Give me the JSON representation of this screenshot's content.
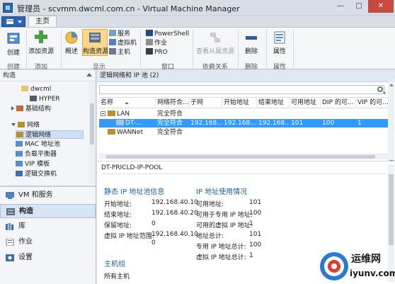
{
  "window": {
    "title": "管理员 - scvmm.dwcml.com.cn - Virtual Machine Manager",
    "minimize": "—",
    "maximize": "□",
    "close": "✕"
  },
  "ribbon": {
    "tab_home": "主页",
    "groups": {
      "create": "创建",
      "add": "添加",
      "show": "显示",
      "window": "窗口",
      "dependencies": "依赖关系",
      "delete": "删除",
      "properties": "属性"
    },
    "buttons": {
      "create": "创建",
      "add_resources": "添加资源",
      "overview": "概述",
      "fabric_resources": "构造资源",
      "services": "服务",
      "vms": "虚拟机",
      "hosts": "主机",
      "powershell": "PowerShell",
      "jobs": "作业",
      "pro": "PRO",
      "view_dependent": "查看从属资源",
      "delete": "删除",
      "properties": "属性"
    }
  },
  "nav": {
    "header": "构造",
    "tree": [
      {
        "label": "dwcml"
      },
      {
        "label": "HYPER"
      },
      {
        "label": "基础结构"
      },
      {
        "label": "网络"
      },
      {
        "label": "逻辑网络"
      },
      {
        "label": "MAC 地址池"
      },
      {
        "label": "负载平衡器"
      },
      {
        "label": "VIP 模板"
      },
      {
        "label": "逻辑交换机"
      }
    ],
    "workspaces": [
      {
        "label": "VM 和服务"
      },
      {
        "label": "构造"
      },
      {
        "label": "库"
      },
      {
        "label": "作业"
      },
      {
        "label": "设置"
      }
    ]
  },
  "main": {
    "header": "逻辑网络和 IP 池 (2)",
    "search_placeholder": "",
    "columns": [
      "名称",
      "网络符合...",
      "子网",
      "开始地址",
      "结束地址",
      "可用地址",
      "DIP 的可...",
      "VIP 的可..."
    ],
    "rows": [
      {
        "name": "LAN",
        "compliance": "完全符合",
        "subnet": "",
        "start": "",
        "end": "",
        "available": "",
        "dip": "",
        "vip": ""
      },
      {
        "name": "DT-...",
        "compliance": "完全符合",
        "subnet": "192.168....",
        "start": "192.168....",
        "end": "192.168....",
        "available": "101",
        "dip": "100",
        "vip": "1"
      },
      {
        "name": "WANNet",
        "compliance": "完全符合",
        "subnet": "",
        "start": "",
        "end": "",
        "available": "",
        "dip": "",
        "vip": ""
      }
    ]
  },
  "detail": {
    "title": "DT-PRICLD-IP-POOL",
    "static_pool_title": "静态 IP 地址池信息",
    "static_pool": [
      {
        "k": "开始地址:",
        "v": "192.168.40.10"
      },
      {
        "k": "结束地址:",
        "v": "192.168.40.20"
      },
      {
        "k": "保留地址:",
        "v": "0"
      },
      {
        "k": "虚拟 IP 地址范围:",
        "v": "192.168.40.10"
      },
      {
        "k": "",
        "v": "0"
      }
    ],
    "usage_title": "IP 地址使用情况",
    "usage": [
      {
        "k": "可用地址:",
        "v": "101"
      },
      {
        "k": "可用于专用 IP 地址:",
        "v": "100"
      },
      {
        "k": "可用的虚拟 IP 地址:",
        "v": "1"
      },
      {
        "k": "地址总计:",
        "v": "101"
      },
      {
        "k": "专用 IP 地址总计:",
        "v": "100"
      },
      {
        "k": "虚拟 IP 地址总计:",
        "v": "1"
      }
    ],
    "host_group_title": "主机组",
    "host_group_value": "所有主机"
  },
  "watermark": {
    "text": "运维网",
    "url": "iyunv.com"
  },
  "colors": {
    "selection": "#3399ff",
    "accent": "#2b63b5",
    "section_title": "#1f5fa8"
  }
}
